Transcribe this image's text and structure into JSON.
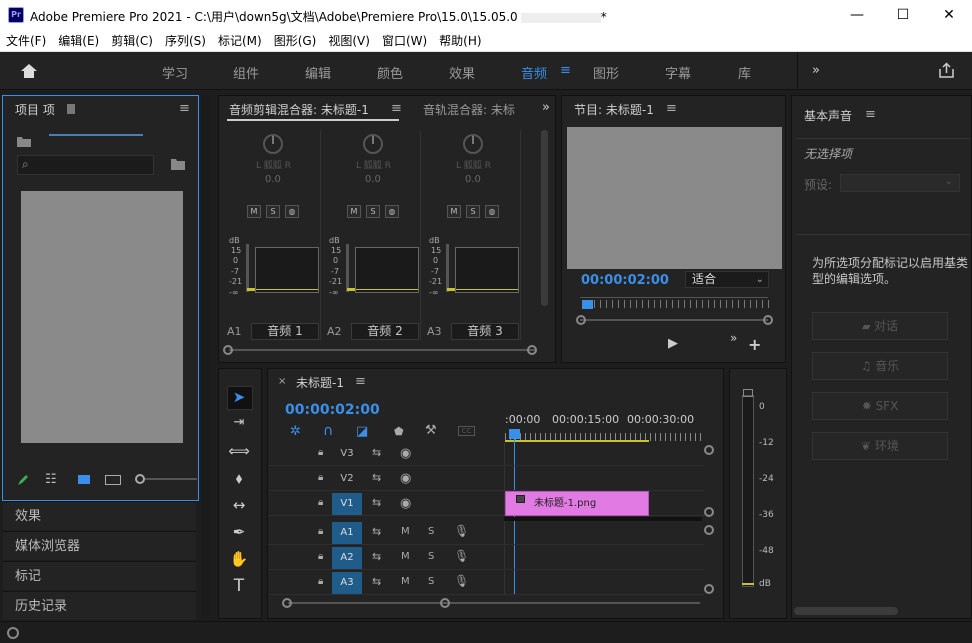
{
  "window": {
    "title": "Adobe Premiere Pro 2021 - C:\\用户\\down5g\\文档\\Adobe\\Premiere Pro\\15.0\\15.05.0",
    "title_suffix": "*",
    "app_badge": "Pr",
    "controls": {
      "minimize": "—",
      "maximize": "☐",
      "close": "✕"
    }
  },
  "menu": [
    "文件(F)",
    "编辑(E)",
    "剪辑(C)",
    "序列(S)",
    "标记(M)",
    "图形(G)",
    "视图(V)",
    "窗口(W)",
    "帮助(H)"
  ],
  "workspaces": [
    "学习",
    "组件",
    "编辑",
    "颜色",
    "效果",
    "音频",
    "图形",
    "字幕",
    "库"
  ],
  "active_workspace": "音频",
  "project_panel": {
    "title": "项目  项",
    "search_placeholder": ""
  },
  "left_list": [
    "效果",
    "媒体浏览器",
    "标记",
    "历史记录"
  ],
  "mixer": {
    "tab1": "音频剪辑混合器: 未标题-1",
    "tab2": "音轨混合器: 未标",
    "lr": "L 胍胍 R",
    "db_value": "0.0",
    "ms_labels": [
      "M",
      "S"
    ],
    "scale": [
      "dB",
      "15",
      "0",
      "-7",
      "-21",
      "-∞"
    ],
    "tracks": [
      {
        "id": "A1",
        "name": "音频 1"
      },
      {
        "id": "A2",
        "name": "音频 2"
      },
      {
        "id": "A3",
        "name": "音频 3"
      }
    ]
  },
  "program": {
    "title": "节目: 未标题-1",
    "timecode": "00:00:02:00",
    "fit": "适合"
  },
  "essential_sound": {
    "title": "基本声音",
    "no_selection": "无选择项",
    "preset_label": "预设:",
    "message": "为所选项分配标记以启用基类型的编辑选项。",
    "buttons": [
      "对话",
      "音乐",
      "SFX",
      "环境"
    ]
  },
  "timeline": {
    "title": "未标题-1",
    "timecode": "00:00:02:00",
    "ruler": [
      ":00:00",
      "00:00:15:00",
      "00:00:30:00"
    ],
    "video_tracks": [
      "V3",
      "V2",
      "V1"
    ],
    "audio_tracks": [
      "A1",
      "A2",
      "A3"
    ],
    "track_m": "M",
    "track_s": "S",
    "clip": "未标题-1.png",
    "clip_color": "#e27ae4"
  },
  "audio_meter": {
    "scale": [
      "0",
      "-12",
      "-24",
      "-36",
      "-48",
      "dB"
    ]
  },
  "colors": {
    "accent": "#3a8fe8",
    "panel": "#232323",
    "bg": "#1d1d1d"
  }
}
